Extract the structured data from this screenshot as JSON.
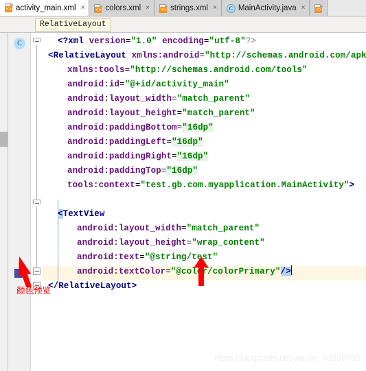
{
  "window": {
    "kind": "android-studio-xml-editor"
  },
  "tabs": [
    {
      "label": "activity_main.xml",
      "icon": "xml-file-icon",
      "active": true,
      "close": "×"
    },
    {
      "label": "colors.xml",
      "icon": "xml-file-icon",
      "active": false,
      "close": "×"
    },
    {
      "label": "strings.xml",
      "icon": "xml-file-icon",
      "active": false,
      "close": "×"
    },
    {
      "label": "MainActivity.java",
      "icon": "java-class-icon",
      "active": false,
      "close": "×"
    },
    {
      "label": "",
      "icon": "xml-file-icon",
      "active": false,
      "close": ""
    }
  ],
  "breadcrumb": {
    "label": "RelativeLayout"
  },
  "gutter": {
    "class_marker": "C",
    "color_swatch_hex": "#3F51B5"
  },
  "code": {
    "lines": [
      {
        "indent": 0,
        "text": "<?xml version=\"1.0\" encoding=\"utf-8\"?>"
      },
      {
        "indent": 0,
        "text": "<RelativeLayout xmlns:android=\"http://schemas.android.com/apk/res/and"
      },
      {
        "indent": 1,
        "text": "xmlns:tools=\"http://schemas.android.com/tools\""
      },
      {
        "indent": 1,
        "text": "android:id=\"@+id/activity_main\""
      },
      {
        "indent": 1,
        "text": "android:layout_width=\"match_parent\""
      },
      {
        "indent": 1,
        "text": "android:layout_height=\"match_parent\""
      },
      {
        "indent": 1,
        "text": "android:paddingBottom=\"16dp\""
      },
      {
        "indent": 1,
        "text": "android:paddingLeft=\"16dp\""
      },
      {
        "indent": 1,
        "text": "android:paddingRight=\"16dp\""
      },
      {
        "indent": 1,
        "text": "android:paddingTop=\"16dp\""
      },
      {
        "indent": 1,
        "text": "tools:context=\"test.gb.com.myapplication.MainActivity\">"
      },
      {
        "indent": 0,
        "text": ""
      },
      {
        "indent": 1,
        "text": "<TextView"
      },
      {
        "indent": 2,
        "text": "android:layout_width=\"match_parent\""
      },
      {
        "indent": 2,
        "text": "android:layout_height=\"wrap_content\""
      },
      {
        "indent": 2,
        "text": "android:text=\"@string/test\""
      },
      {
        "indent": 2,
        "text": "android:textColor=\"@color/colorPrimary\"/>"
      },
      {
        "indent": 0,
        "text": "</RelativeLayout>"
      }
    ],
    "tokens": {
      "pi_open": "<?",
      "pi_name": "xml",
      "pi_close": "?>",
      "attr_version": "version",
      "val_version": "\"1.0\"",
      "attr_encoding": "encoding",
      "val_encoding": "\"utf-8\"",
      "tag_relativelayout_open": "<RelativeLayout",
      "tag_relativelayout_close": "</RelativeLayout>",
      "tag_textview_open_bracket": "<",
      "tag_textview_name": "TextView",
      "attr_xmlns_android": "xmlns:android",
      "val_xmlns_android": "\"http://schemas.android.com/apk/res/and",
      "attr_xmlns_tools": "xmlns:tools",
      "val_xmlns_tools": "\"http://schemas.android.com/tools\"",
      "ns_android": "android",
      "ns_tools": "tools",
      "attr_id": "id",
      "val_id": "\"@+id/activity_main\"",
      "attr_layout_width": "layout_width",
      "val_match_parent": "\"match_parent\"",
      "attr_layout_height": "layout_height",
      "val_wrap_content": "\"wrap_content\"",
      "attr_paddingBottom": "paddingBottom",
      "attr_paddingLeft": "paddingLeft",
      "attr_paddingRight": "paddingRight",
      "attr_paddingTop": "paddingTop",
      "val_16dp": "\"16dp\"",
      "attr_context": "context",
      "val_context": "\"test.gb.com.myapplication.MainActivity\"",
      "gt": ">",
      "attr_text": "text",
      "val_text": "\"@string/test\"",
      "attr_textColor": "textColor",
      "val_textColor": "\"@color/colorPrimary\"",
      "self_close": "/>",
      "eq": "="
    }
  },
  "annotations": {
    "color_preview_note": "颜色预览"
  },
  "watermark": {
    "text": "https://blog.csdn.net/weixin_43838785"
  }
}
